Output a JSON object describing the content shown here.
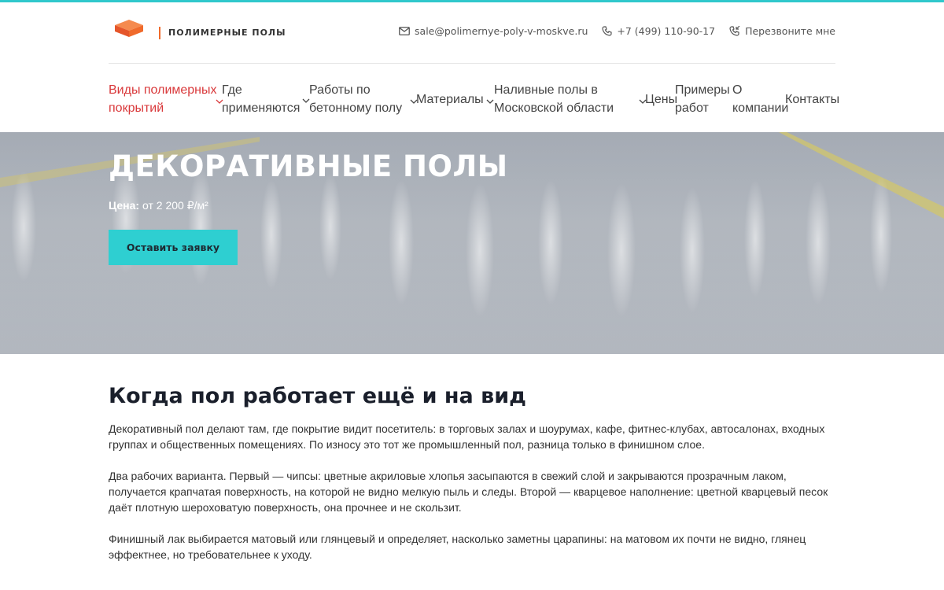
{
  "brand": {
    "name": "ПОЛИМЕРНЫЕ ПОЛЫ",
    "accent_color": "#2fc8cc",
    "logo_color": "#f06a2b"
  },
  "contacts": {
    "email": "sale@polimernye-poly-v-moskve.ru",
    "phone": "+7 (499) 110-90-17",
    "callback": "Перезвоните мне",
    "icons": [
      "mail-icon",
      "phone-icon",
      "phone-callback-icon"
    ]
  },
  "nav": {
    "items": [
      {
        "line1": "Виды полимерных",
        "line2": "покрытий",
        "active": true,
        "dropdown": true
      },
      {
        "line1": "Где",
        "line2": "применяются",
        "dropdown": true
      },
      {
        "line1": "Работы по",
        "line2": "бетонному полу",
        "dropdown": true
      },
      {
        "line1": "Материалы",
        "dropdown": true
      },
      {
        "line1": "Наливные полы в",
        "line2": "Московской области",
        "dropdown": true
      },
      {
        "line1": "Цены"
      },
      {
        "line1": "Примеры",
        "line2": "работ"
      },
      {
        "line1": "О",
        "line2": "компании"
      },
      {
        "line1": "Контакты"
      }
    ],
    "active_color": "#d9383a"
  },
  "hero": {
    "title": "ДЕКОРАТИВНЫЕ ПОЛЫ",
    "price_label": "Цена:",
    "price_value": "от 2 200 ₽/м²",
    "cta_label": "Оставить заявку",
    "cta_color": "#2ecfd1"
  },
  "article": {
    "heading": "Когда пол работает ещё и на вид",
    "paragraphs": [
      "Декоративный пол делают там, где покрытие видит посетитель: в торговых залах и шоурумах, кафе, фитнес-клубах, автосалонах, входных группах и общественных помещениях. По износу это тот же промышленный пол, разница только в финишном слое.",
      "Два рабочих варианта. Первый — чипсы: цветные акриловые хлопья засыпаются в свежий слой и закрываются прозрачным лаком, получается крапчатая поверхность, на которой не видно мелкую пыль и следы. Второй — кварцевое наполнение: цветной кварцевый песок даёт плотную шероховатую поверхность, она прочнее и не скользит.",
      "Финишный лак выбирается матовый или глянцевый и определяет, насколько заметны царапины: на матовом их почти не видно, глянец эффектнее, но требовательнее к уходу."
    ]
  }
}
